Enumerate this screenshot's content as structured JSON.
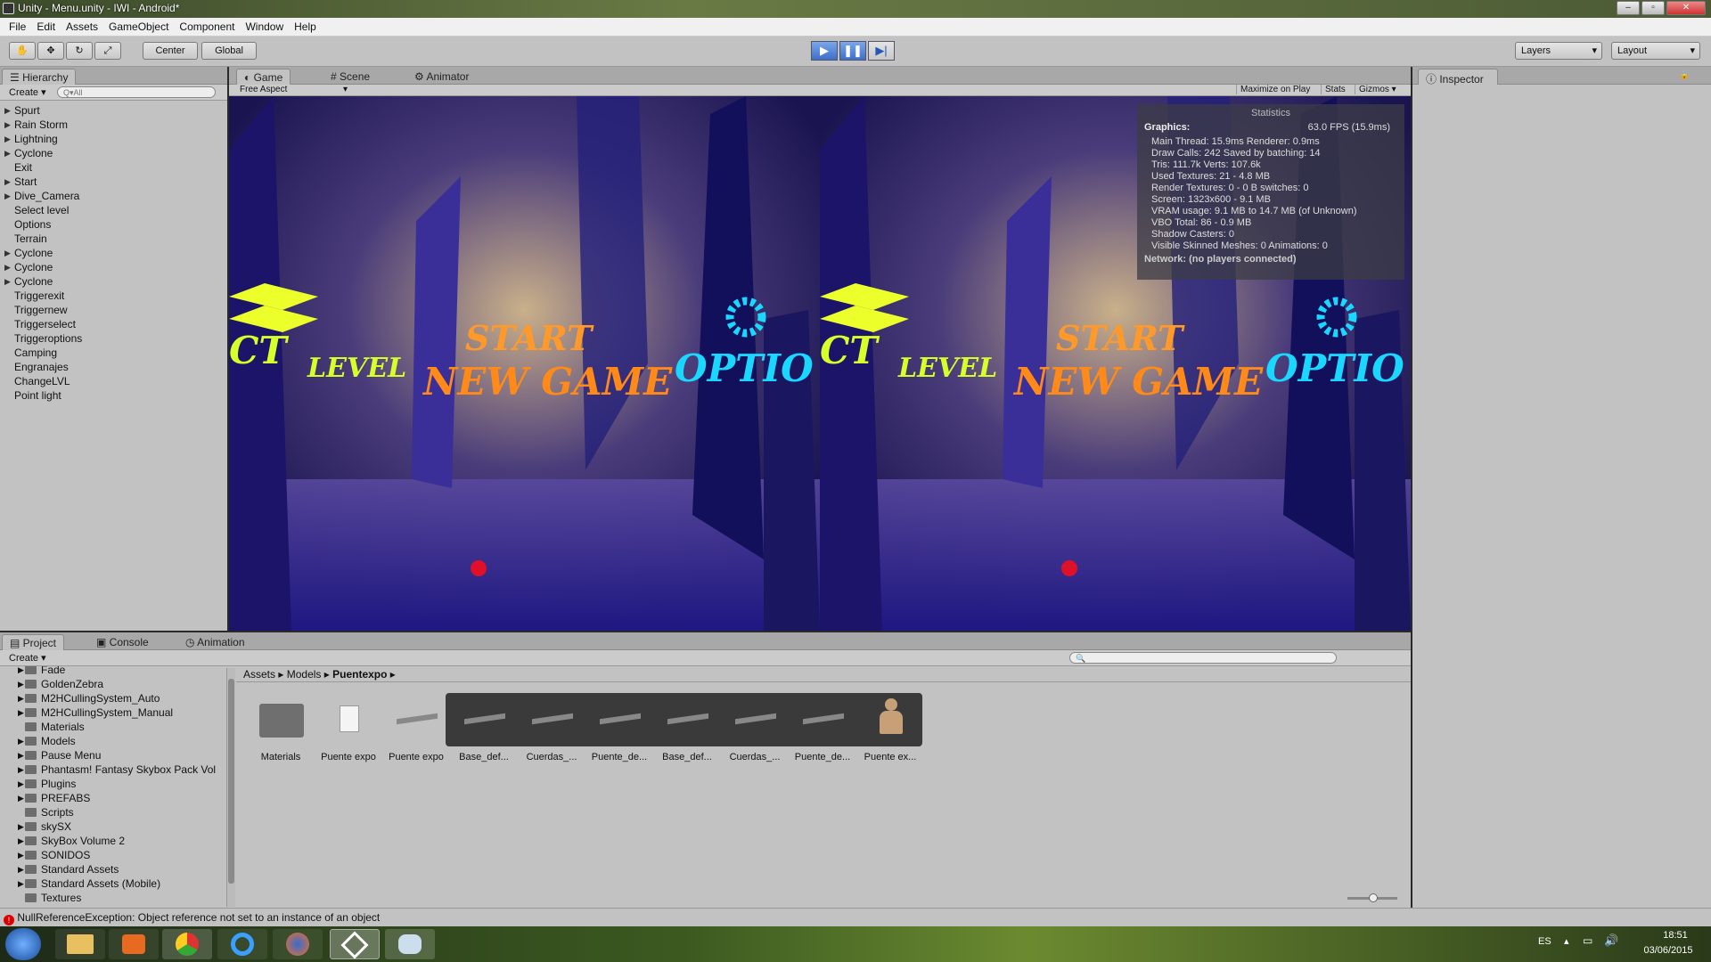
{
  "window": {
    "title": "Unity - Menu.unity - IWI - Android*"
  },
  "menu": [
    "File",
    "Edit",
    "Assets",
    "GameObject",
    "Component",
    "Window",
    "Help"
  ],
  "toolbar": {
    "center": "Center",
    "global": "Global",
    "layers": "Layers",
    "layout": "Layout"
  },
  "hierarchy": {
    "tab": "Hierarchy",
    "create": "Create",
    "search_placeholder": "Q▾All",
    "items": [
      {
        "label": "Spurt",
        "arrow": true
      },
      {
        "label": "Rain Storm",
        "arrow": true
      },
      {
        "label": "Lightning",
        "arrow": true
      },
      {
        "label": "Cyclone",
        "arrow": true
      },
      {
        "label": "Exit",
        "arrow": false
      },
      {
        "label": "Start",
        "arrow": true
      },
      {
        "label": "Dive_Camera",
        "arrow": true
      },
      {
        "label": "Select level",
        "arrow": false
      },
      {
        "label": "Options",
        "arrow": false
      },
      {
        "label": "Terrain",
        "arrow": false
      },
      {
        "label": "Cyclone",
        "arrow": true
      },
      {
        "label": "Cyclone",
        "arrow": true
      },
      {
        "label": "Cyclone",
        "arrow": true
      },
      {
        "label": "Triggerexit",
        "arrow": false
      },
      {
        "label": "Triggernew",
        "arrow": false
      },
      {
        "label": "Triggerselect",
        "arrow": false
      },
      {
        "label": "Triggeroptions",
        "arrow": false
      },
      {
        "label": "Camping",
        "arrow": false
      },
      {
        "label": "Engranajes",
        "arrow": false
      },
      {
        "label": "ChangeLVL",
        "arrow": false
      },
      {
        "label": "Point light",
        "arrow": false
      }
    ]
  },
  "game": {
    "tabs": [
      "Game",
      "Scene",
      "Animator"
    ],
    "aspect": "Free Aspect",
    "maximize": "Maximize on Play",
    "stats_btn": "Stats",
    "gizmos": "Gizmos",
    "scene_text": {
      "level": "LEVEL",
      "start": "START",
      "new_game": "NEW GAME",
      "options": "OPTIO",
      "sel": "CT"
    }
  },
  "statistics": {
    "title": "Statistics",
    "graphics": "Graphics:",
    "fps": "63.0 FPS (15.9ms)",
    "lines": [
      "Main Thread: 15.9ms  Renderer: 0.9ms",
      "Draw Calls: 242   Saved by batching: 14",
      "Tris: 111.7k     Verts: 107.6k",
      "Used Textures: 21 - 4.8 MB",
      "Render Textures: 0 - 0 B   switches: 0",
      "Screen: 1323x600 - 9.1 MB",
      "VRAM usage: 9.1 MB to 14.7 MB (of Unknown)",
      "VBO Total: 86 - 0.9 MB",
      "Shadow Casters: 0",
      "Visible Skinned Meshes: 0     Animations: 0"
    ],
    "network": "Network: (no players connected)"
  },
  "inspector": {
    "tab": "Inspector"
  },
  "project": {
    "tabs": [
      "Project",
      "Console",
      "Animation"
    ],
    "create": "Create",
    "folders": [
      "Fade",
      "GoldenZebra",
      "M2HCullingSystem_Auto",
      "M2HCullingSystem_Manual",
      "Materials",
      "Models",
      "Pause Menu",
      "Phantasm! Fantasy Skybox Pack Vol",
      "Plugins",
      "PREFABS",
      "Scripts",
      "skySX",
      "SkyBox Volume 2",
      "SONIDOS",
      "Standard Assets",
      "Standard Assets (Mobile)",
      "Textures"
    ],
    "breadcrumb": [
      "Assets",
      "Models",
      "Puentexpo"
    ],
    "assets": [
      "Materials",
      "Puente expo",
      "Puente expo",
      "Base_def...",
      "Cuerdas_...",
      "Puente_de...",
      "Base_def...",
      "Cuerdas_...",
      "Puente_de...",
      "Puente ex..."
    ]
  },
  "status": {
    "error": "NullReferenceException: Object reference not set to an instance of an object"
  },
  "taskbar": {
    "lang": "ES",
    "time": "18:51",
    "date": "03/06/2015"
  }
}
